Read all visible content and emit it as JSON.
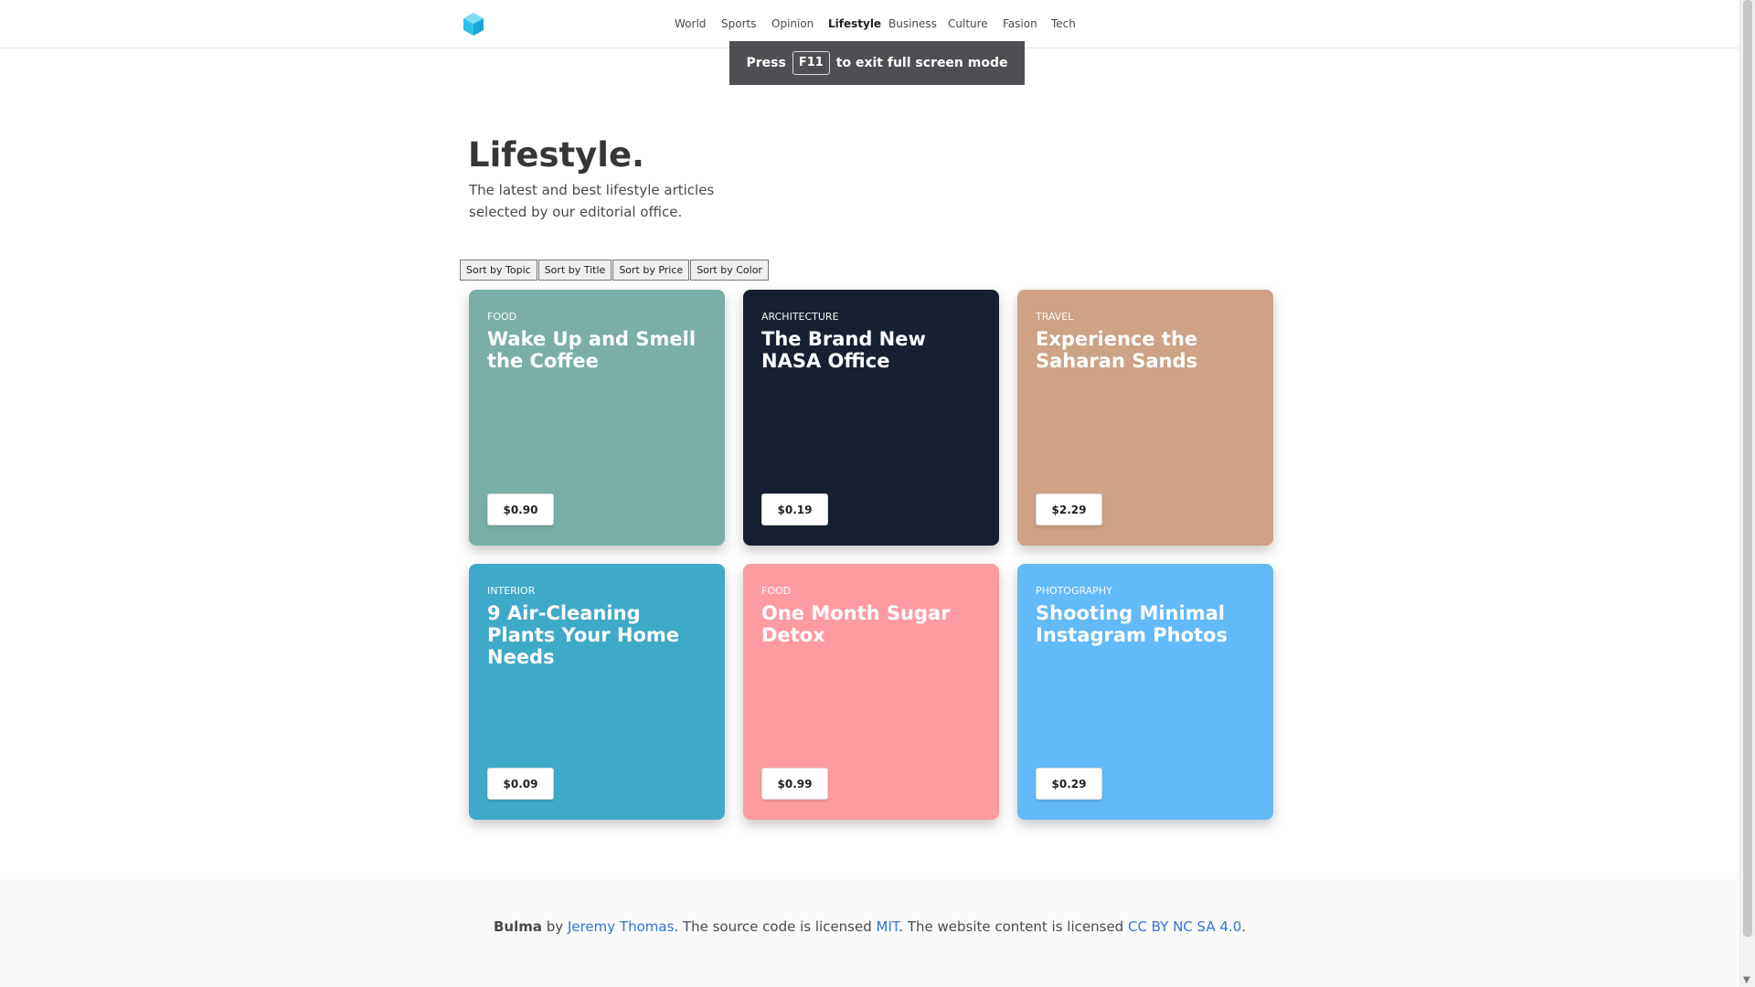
{
  "nav": {
    "links": [
      "World",
      "Sports",
      "Opinion",
      "Lifestyle",
      "Business",
      "Culture",
      "Fasion",
      "Tech"
    ],
    "active": "Lifestyle"
  },
  "toast": {
    "press": "Press",
    "key": "F11",
    "rest": "to exit full screen mode"
  },
  "hero": {
    "title": "Lifestyle.",
    "subtitle": "The latest and best lifestyle articles selected by our editorial office."
  },
  "sort_buttons": [
    "Sort by Topic",
    "Sort by Title",
    "Sort by Price",
    "Sort by Color"
  ],
  "cards": [
    {
      "topic": "Food",
      "title": "Wake Up and Smell the Coffee",
      "price": "$0.90",
      "color": "#7aaea7"
    },
    {
      "topic": "Architecture",
      "title": "The Brand New NASA Office",
      "price": "$0.19",
      "color": "#172030"
    },
    {
      "topic": "Travel",
      "title": "Experience the Saharan Sands",
      "price": "$2.29",
      "color": "#cda286"
    },
    {
      "topic": "Interior",
      "title": "9 Air-Cleaning Plants Your Home Needs",
      "price": "$0.09",
      "color": "#3fa9c9"
    },
    {
      "topic": "Food",
      "title": "One Month Sugar Detox",
      "price": "$0.99",
      "color": "#fe9ba1"
    },
    {
      "topic": "Photography",
      "title": "Shooting Minimal Instagram Photos",
      "price": "$0.29",
      "color": "#62baf8"
    }
  ],
  "footer": {
    "brand": "Bulma",
    "by": " by ",
    "author": "Jeremy Thomas",
    "mid": ". The source code is licensed ",
    "code_license": "MIT",
    "mid2": ". The website content is licensed ",
    "content_license": "CC BY NC SA 4.0",
    "end": "."
  }
}
